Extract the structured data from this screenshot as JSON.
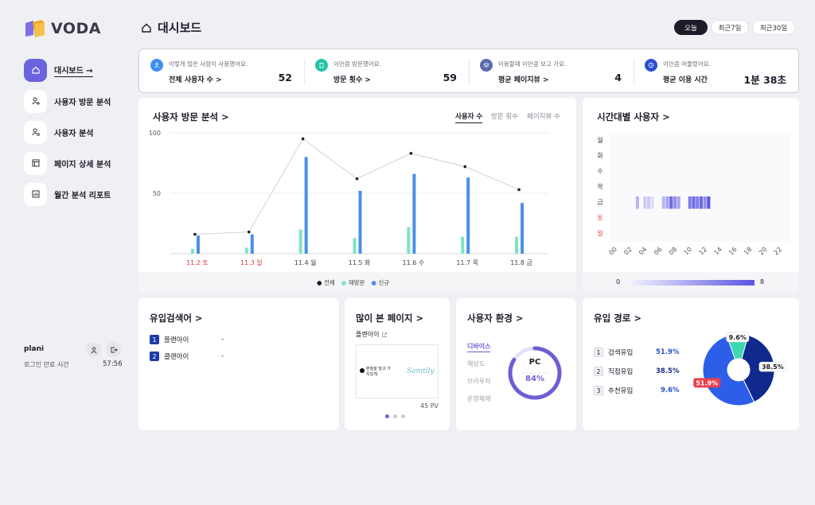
{
  "brand": {
    "name": "VODA"
  },
  "header": {
    "title": "대시보드",
    "ranges": [
      "오늘",
      "최근7일",
      "최근30일"
    ],
    "active_range": "오늘"
  },
  "sidebar": {
    "items": [
      {
        "label": "대시보드 →",
        "icon": "home-icon"
      },
      {
        "label": "사용자 방문 분석",
        "icon": "user-plus-icon"
      },
      {
        "label": "사용자 분석",
        "icon": "user-search-icon"
      },
      {
        "label": "페이지 상세 분석",
        "icon": "layout-icon"
      },
      {
        "label": "월간 분석 리포트",
        "icon": "report-icon"
      }
    ],
    "user": {
      "name": "plani",
      "logout_label": "로그인 만료 시간",
      "time": "57:56"
    }
  },
  "stats": [
    {
      "desc": "이렇게 많은 사람이 사용했어요.",
      "label": "전체 사용자 수 >",
      "value": "52",
      "color": "#3d8ef0"
    },
    {
      "desc": "이만큼 방문했어요.",
      "label": "방문 횟수 >",
      "value": "59",
      "color": "#22c3a8"
    },
    {
      "desc": "이용할때 이만큼 보고 가요.",
      "label": "평균 페이지뷰 >",
      "value": "4",
      "color": "#5b6bb0"
    },
    {
      "desc": "이만큼 머물렀어요.",
      "label": "평균 이용 시간",
      "value": "1분 38초",
      "color": "#2b4fcf"
    }
  ],
  "visit_analysis": {
    "title": "사용자 방문 분석 >",
    "tabs": [
      "사용자 수",
      "방문 횟수",
      "페이지뷰 수"
    ],
    "legend": [
      "전체",
      "재방문",
      "신규"
    ],
    "chart_data": {
      "type": "bar",
      "categories": [
        "11.2 토",
        "11.3 일",
        "11.4 월",
        "11.5 화",
        "11.6 수",
        "11.7 목",
        "11.8 금"
      ],
      "weekend": [
        true,
        true,
        false,
        false,
        false,
        false,
        false
      ],
      "series": [
        {
          "name": "전체",
          "kind": "line",
          "color": "#1c1c28",
          "values": [
            16,
            18,
            95,
            62,
            83,
            72,
            53
          ]
        },
        {
          "name": "재방문",
          "kind": "bar",
          "color": "#7fe3c4",
          "values": [
            4,
            5,
            20,
            13,
            22,
            14,
            14
          ]
        },
        {
          "name": "신규",
          "kind": "bar",
          "color": "#4a8fe8",
          "values": [
            15,
            16,
            80,
            52,
            66,
            63,
            42
          ]
        }
      ],
      "yticks": [
        "100",
        "50"
      ],
      "ylim": [
        0,
        100
      ]
    }
  },
  "time_users": {
    "title": "시간대별 사용자 >",
    "days": [
      "월",
      "화",
      "수",
      "목",
      "금",
      "토",
      "일"
    ],
    "weekend_days": [
      false,
      false,
      false,
      false,
      false,
      true,
      true
    ],
    "hours": [
      "00",
      "02",
      "04",
      "06",
      "08",
      "10",
      "12",
      "14",
      "16",
      "18",
      "20",
      "22"
    ],
    "scale_min": "0",
    "scale_max": "8",
    "chart_data": {
      "type": "heatmap",
      "row": "금",
      "values": [
        0,
        0,
        0,
        0,
        3,
        0,
        2,
        2,
        1,
        0,
        0,
        3,
        4,
        7,
        5,
        4,
        0,
        0,
        6,
        7,
        6,
        7,
        5,
        8,
        0,
        0,
        0,
        0,
        0,
        0,
        0,
        0,
        0,
        0,
        0,
        0,
        0,
        0,
        0,
        0,
        0,
        0,
        0,
        0,
        0,
        0,
        0,
        0
      ]
    }
  },
  "search_engines": {
    "title": "유입검색어 >",
    "items": [
      {
        "rank": "1",
        "label": "플랜아이",
        "value": "-"
      },
      {
        "rank": "2",
        "label": "클랜아이",
        "value": "-"
      }
    ]
  },
  "top_pages": {
    "title": "많이 본 페이지 >",
    "page_name": "플랜아이",
    "thumbnail_text": "본질을 담고 가치있게.",
    "thumbnail_signature": "Samtily",
    "pv": "45 PV"
  },
  "env": {
    "title": "사용자 환경 >",
    "tabs": [
      "디바이스",
      "해상도",
      "브라우저",
      "운영체제"
    ],
    "label": "PC",
    "percent_label": "84%",
    "percent": 84,
    "color": "#6b5fd6"
  },
  "referrer": {
    "title": "유입 경로 >",
    "items": [
      {
        "rank": "1",
        "label": "검색유입",
        "value": "51.9%"
      },
      {
        "rank": "2",
        "label": "직접유입",
        "value": "38.5%"
      },
      {
        "rank": "3",
        "label": "추천유입",
        "value": "9.6%"
      }
    ],
    "chart_data": {
      "type": "pie",
      "labels": [
        "검색유입",
        "직접유입",
        "추천유입"
      ],
      "values": [
        51.9,
        38.5,
        9.6
      ],
      "colors": [
        "#2c5ee8",
        "#0f2a8c",
        "#3ed6b0"
      ],
      "value_labels": [
        "51.9%",
        "38.5%",
        "9.6%"
      ]
    }
  }
}
